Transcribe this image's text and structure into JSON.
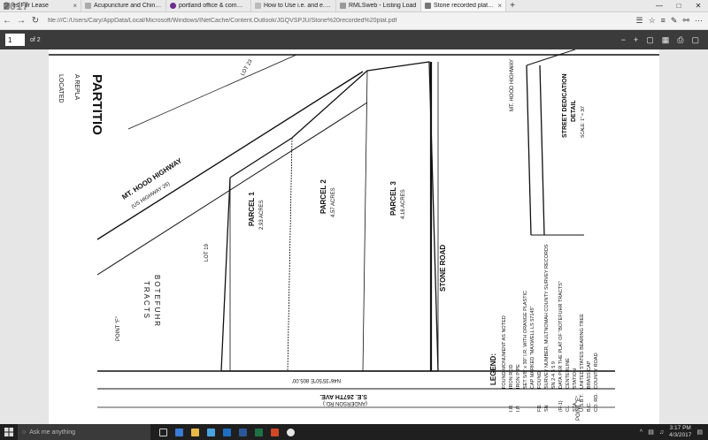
{
  "browser": {
    "watermark": "2017",
    "tabs": [
      {
        "label": "es For Lease",
        "active": false
      },
      {
        "label": "Acupuncture and Chinese M",
        "active": false
      },
      {
        "label": "portland office & commerci",
        "active": false
      },
      {
        "label": "How to Use i.e. and e.g. Cor",
        "active": false
      },
      {
        "label": "RMLSweb - Listing Load",
        "active": false
      },
      {
        "label": "Stone recorded plat.pdf",
        "active": true
      }
    ],
    "new_tab_icon": "plus-icon",
    "url": "file:///C:/Users/Cary/AppData/Local/Microsoft/Windows/INetCache/Content.Outlook/JGQVSPJU/Stone%20recorded%20plat.pdf"
  },
  "pdf_toolbar": {
    "page_current": "1",
    "page_total": "of 2"
  },
  "plat": {
    "highway": "MT. HOOD HIGHWAY",
    "highway_sub": "(US HIGHWAY 26)",
    "title_partial": "PARTITIO",
    "subtitle_1": "A REPLA",
    "subtitle_2": "LOCATED",
    "parcel1": "PARCEL 1",
    "parcel1_area": "2.93 ACRES",
    "parcel2": "PARCEL 2",
    "parcel2_area": "4.57 ACRES",
    "parcel3": "PARCEL 3",
    "parcel3_area": "4.16 ACRES",
    "stone_road": "STONE ROAD",
    "street_dedication": "STREET DEDICATION",
    "detail": "DETAIL",
    "scale": "SCALE: 1\" = 30'",
    "mt_hood_right": "MT. HOOD HIGHWAY",
    "botefuhr": "BOTEFUHR",
    "tracts": "TRACTS",
    "bearing_1": "N46°35'50\"E 805.00'",
    "bearing_2": "S.E. 267TH AVE.",
    "bearing_3": "(ANDERSON RD.)",
    "lot_19": "LOT 19",
    "lot_23": "LOT 23",
    "legend_title": "LEGEND:",
    "legend": [
      "FOUND MONUMENT AS NOTED",
      "IRON ROD",
      "IRON PIPE",
      "SET 5/8\" x 30\" I.R. WITH ORANGE PLASTIC",
      "CAP MARKED \"MAXWELL LS 57145\"",
      "FOUND",
      "SURVEY NUMBER, MULTNOMAH COUNTY SURVEY RECORDS",
      "SN 2-4 3 5 9",
      "DATA PER THE PLAT OF \"BOTEFUHR TRACTS\"",
      "CENTERLINE",
      "STATION",
      "UNITED STATES BEARING TREE",
      "BRASS CAP",
      "COUNTY ROAD"
    ],
    "legend_abbr": [
      "",
      "I.R.",
      "I.P.",
      "",
      "",
      "FD.",
      "SN",
      "",
      "(R-1)",
      "CL",
      "STA.",
      "U.S.B.T.",
      "B.C.",
      "CO. RD."
    ],
    "point_f": "POINT \"F\"",
    "point_e": "POINT \"E\""
  },
  "taskbar": {
    "search_placeholder": "Ask me anything",
    "time": "3:17 PM",
    "date": "4/3/2017"
  },
  "colors": {
    "pdf_toolbar_bg": "#3b3b3b",
    "taskbar_bg": "#1f1f1f"
  }
}
